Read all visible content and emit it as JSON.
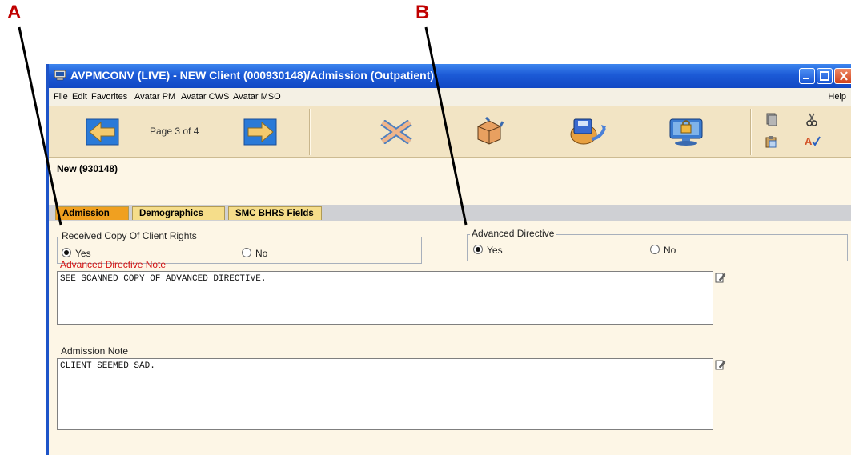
{
  "callouts": {
    "a": "A",
    "b": "B"
  },
  "window": {
    "title": "AVPMCONV (LIVE) - NEW Client (000930148)/Admission (Outpatient)"
  },
  "menu": {
    "file": "File",
    "edit": "Edit",
    "favorites": "Favorites",
    "avatar_pm": "Avatar PM",
    "avatar_cws": "Avatar CWS",
    "avatar_mso": "Avatar MSO",
    "help": "Help"
  },
  "toolbar": {
    "page_label": "Page 3 of 4",
    "icons": [
      "back-arrow-icon",
      "forward-arrow-icon",
      "cancel-x-icon",
      "open-box-icon",
      "submit-disk-icon",
      "lock-monitor-icon",
      "copy-icon",
      "cut-icon",
      "paste-icon",
      "spellcheck-icon"
    ]
  },
  "breadcrumb": "New (930148)",
  "tabs": [
    {
      "label": "Admission",
      "active": true
    },
    {
      "label": "Demographics",
      "active": false
    },
    {
      "label": "SMC BHRS Fields",
      "active": false
    }
  ],
  "client_rights": {
    "legend": "Received Copy Of Client Rights",
    "yes": "Yes",
    "no": "No",
    "selected": "Yes"
  },
  "advanced_directive": {
    "legend": "Advanced Directive",
    "yes": "Yes",
    "no": "No",
    "selected": "Yes"
  },
  "ad_note": {
    "label": "Advanced Directive Note",
    "value": "SEE SCANNED COPY OF ADVANCED DIRECTIVE."
  },
  "admission_note": {
    "label": "Admission Note",
    "value": "CLIENT SEEMED SAD."
  },
  "colors": {
    "required_label": "#d51212",
    "tab_active": "#f0a020",
    "tab_inactive": "#f5dd8a",
    "form_bg": "#fdf6e6",
    "titlebar": "#1c5ad6"
  }
}
